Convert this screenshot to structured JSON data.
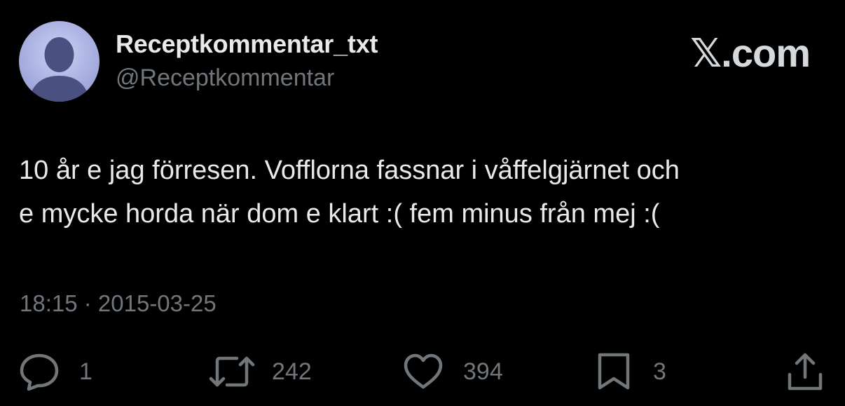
{
  "author": {
    "display_name": "Receptkommentar_txt",
    "handle": "@Receptkommentar",
    "avatar_icon": "default-profile-silhouette-icon"
  },
  "site": {
    "logo_text": "𝕏.com"
  },
  "tweet": {
    "text": "10 år e jag förresen. Vofflorna fassnar i våffelgjärnet och\ne mycke horda när dom e klart :( fem minus från mej :(",
    "timestamp": "18:15 · 2015-03-25"
  },
  "actions": {
    "reply": {
      "icon": "reply-icon",
      "count": "1"
    },
    "repost": {
      "icon": "repost-icon",
      "count": "242"
    },
    "like": {
      "icon": "heart-icon",
      "count": "394"
    },
    "bookmark": {
      "icon": "bookmark-icon",
      "count": "3"
    },
    "share": {
      "icon": "share-icon"
    }
  },
  "colors": {
    "background": "#000000",
    "primary_text": "#e7e9ea",
    "secondary_text": "#71767b",
    "avatar_bg": "#a9afe0"
  }
}
